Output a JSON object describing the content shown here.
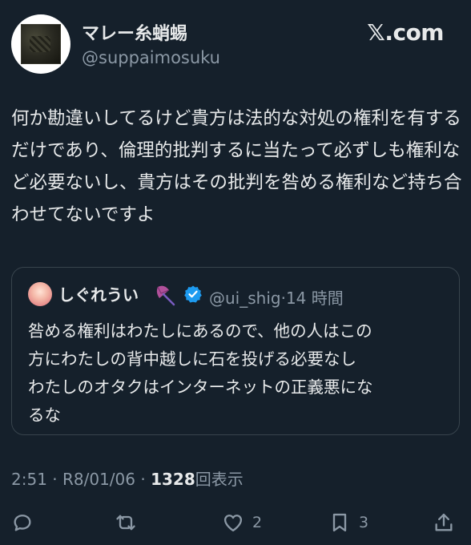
{
  "author": {
    "display_name": "マレー糸蛸蜴",
    "handle": "@suppaimosuku"
  },
  "brand": "𝕏.com",
  "tweet": {
    "text": "何か勘違いしてるけど貴方は法的な対処の権利を有するだけであり、倫理的批判するに当たって必ずしも権利など必要ないし、貴方はその批判を咎める権利など持ち合わせてないですよ"
  },
  "quoted": {
    "display_name": "しぐれうい",
    "handle": "@ui_shig",
    "separator": "·",
    "time": "14 時間",
    "text": "咎める権利はわたしにあるので、他の人はこの\n方にわたしの背中越しに石を投げる必要なし\nわたしのオタクはインターネットの正義悪にな\nるな"
  },
  "meta": {
    "time": "2:51",
    "sep1": "·",
    "date": "R8/01/06",
    "sep2": "·",
    "views": "1328",
    "views_label": "回表示"
  },
  "actions": {
    "reply_icon": "reply-icon",
    "retweet_icon": "retweet-icon",
    "like_icon": "heart-icon",
    "like_count": "2",
    "bookmark_icon": "bookmark-icon",
    "bookmark_count": "3",
    "share_icon": "share-icon"
  },
  "colors": {
    "background": "#15202b",
    "text": "#e7e9ea",
    "secondary": "#8b98a5",
    "border": "#38444d",
    "verified": "#1d9bf0"
  }
}
